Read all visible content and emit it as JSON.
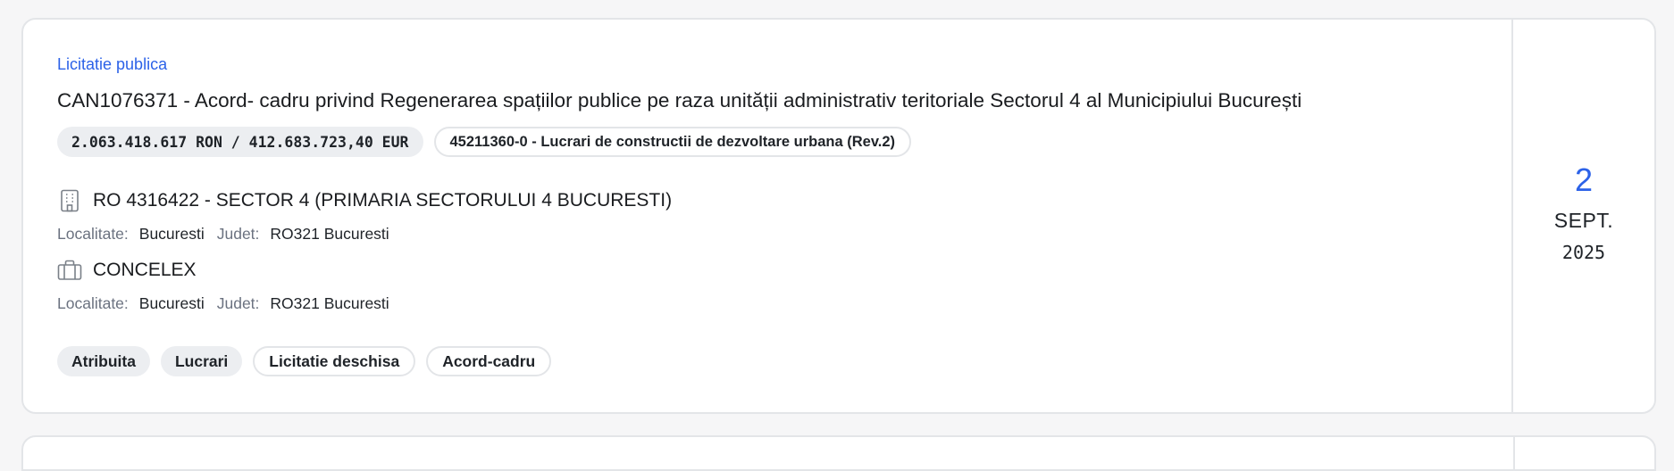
{
  "card": {
    "category": "Licitatie publica",
    "title": "CAN1076371 - Acord- cadru privind Regenerarea spațiilor publice pe raza unității administrativ teritoriale Sectorul 4 al Municipiului București",
    "value_chip": "2.063.418.617 RON / 412.683.723,40 EUR",
    "cpv_chip": "45211360-0 - Lucrari de constructii de dezvoltare urbana (Rev.2)",
    "authority": {
      "icon": "building-icon",
      "name": "RO 4316422 - SECTOR 4 (PRIMARIA SECTORULUI 4 BUCURESTI)",
      "localitate_label": "Localitate:",
      "localitate_value": "Bucuresti",
      "judet_label": "Judet:",
      "judet_value": "RO321 Bucuresti"
    },
    "contractor": {
      "icon": "briefcase-icon",
      "name": "CONCELEX",
      "localitate_label": "Localitate:",
      "localitate_value": "Bucuresti",
      "judet_label": "Judet:",
      "judet_value": "RO321 Bucuresti"
    },
    "tags": [
      {
        "label": "Atribuita",
        "style": "filled"
      },
      {
        "label": "Lucrari",
        "style": "filled"
      },
      {
        "label": "Licitatie deschisa",
        "style": "outline"
      },
      {
        "label": "Acord-cadru",
        "style": "outline"
      }
    ],
    "date": {
      "day": "2",
      "month": "SEPT.",
      "year": "2025"
    }
  },
  "colors": {
    "accent": "#2c62e8",
    "border": "#e3e5e8",
    "chip_bg": "#eceef1",
    "muted_text": "#6b7280"
  }
}
